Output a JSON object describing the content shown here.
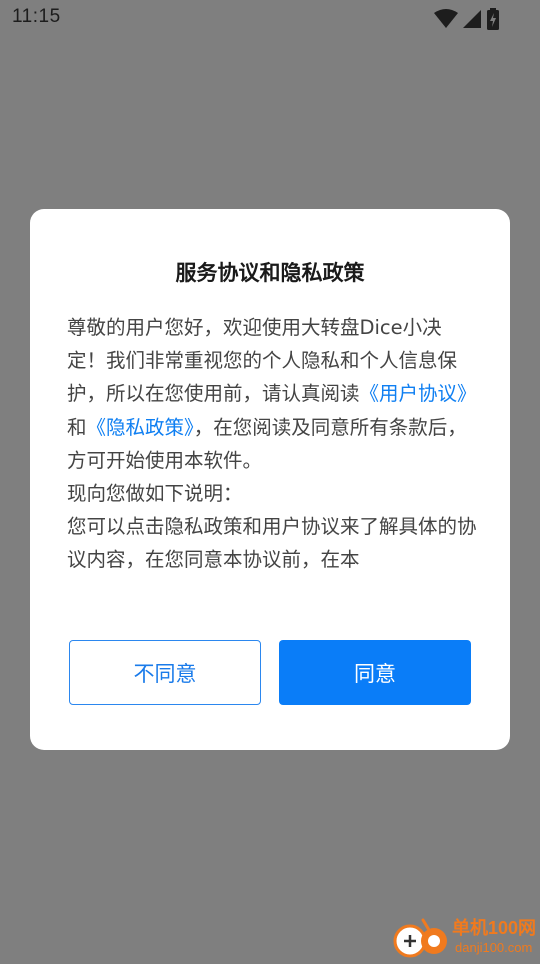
{
  "status_bar": {
    "time": "11:15",
    "icons": [
      "wifi-icon",
      "cellular-signal-icon",
      "battery-charging-icon"
    ]
  },
  "dialog": {
    "title": "服务协议和隐私政策",
    "body": {
      "intro": "尊敬的用户您好，欢迎使用大转盘Dice小决定！我们非常重视您的个人隐私和个人信息保护，所以在您使用前，请认真阅读",
      "link_user_agreement": "《用户协议》",
      "and": "和",
      "link_privacy_policy": "《隐私政策》",
      "after_links": "，在您阅读及同意所有条款后，方可开始使用本软件。",
      "notice_heading": "现向您做如下说明：",
      "notice_text": "您可以点击隐私政策和用户协议来了解具体的协议内容，在您同意本协议前，在本"
    },
    "buttons": {
      "disagree": "不同意",
      "agree": "同意"
    }
  },
  "watermark": {
    "brand": "单机100网",
    "url": "danji100.com"
  },
  "colors": {
    "overlay": "#7f7f7f",
    "accent": "#0a7df8",
    "link": "#0f7ff2",
    "watermark": "#f07a1e"
  }
}
